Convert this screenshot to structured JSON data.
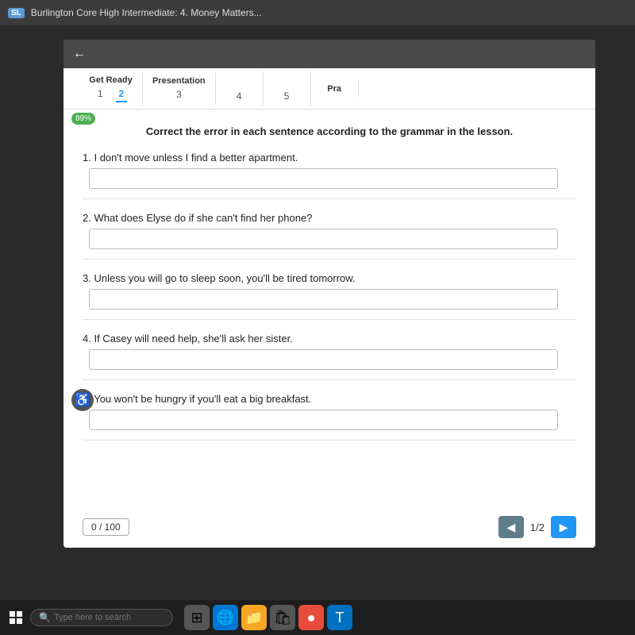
{
  "browser": {
    "badge": "SL",
    "title": "Burlington Core High Intermediate: 4. Money Matters..."
  },
  "tabs": {
    "get_ready_label": "Get Ready",
    "get_ready_nums": [
      "1",
      "2"
    ],
    "presentation_label": "Presentation",
    "presentation_num": "3",
    "tab4": "4",
    "tab5": "5",
    "pra_label": "Pra"
  },
  "progress": "89%",
  "instruction": "Correct the error in each sentence according to the grammar in the lesson.",
  "questions": [
    {
      "number": "1.",
      "text": "I don't move unless I find a better apartment.",
      "placeholder": ""
    },
    {
      "number": "2.",
      "text": "What does Elyse do if she can't find her phone?",
      "placeholder": ""
    },
    {
      "number": "3.",
      "text": "Unless you will go to sleep soon, you'll be tired tomorrow.",
      "placeholder": ""
    },
    {
      "number": "4.",
      "text": "If Casey will need help, she'll ask her sister.",
      "placeholder": ""
    },
    {
      "number": "5.",
      "text": "You won't be hungry if you'll eat a big breakfast.",
      "placeholder": ""
    }
  ],
  "score": {
    "current": "0",
    "total": "100",
    "label": "0 / 100"
  },
  "pagination": {
    "page": "1/2",
    "prev_label": "◀",
    "next_label": "▶"
  },
  "taskbar": {
    "search_placeholder": "Type here to search"
  },
  "back_arrow": "←"
}
